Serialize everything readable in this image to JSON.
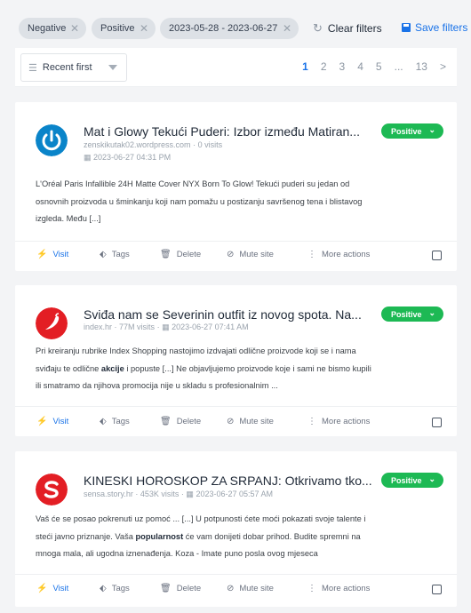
{
  "filters": {
    "chips": [
      {
        "label": "Negative"
      },
      {
        "label": "Positive"
      },
      {
        "label": "2023-05-28 - 2023-06-27"
      }
    ],
    "clear_label": "Clear filters",
    "save_label": "Save filters"
  },
  "toolbar": {
    "sort_label": "Recent first",
    "pages": [
      "1",
      "2",
      "3",
      "4",
      "5",
      "...",
      "13",
      ">"
    ],
    "active_page": "1"
  },
  "colors": {
    "accent": "#1a73e8",
    "positive": "#1db954"
  },
  "results": [
    {
      "title": "Mat i Glowy Tekući Puderi: Izbor između Matiran...",
      "source": "zenskikutak02.wordpress.com",
      "visits": "0 visits",
      "date": "2023-06-27 04:31 PM",
      "sentiment": "Positive",
      "logo_icon": "power-logo-icon",
      "snippet_lines": [
        "L'Oréal Paris Infallible 24H Matte Cover NYX Born To Glow! Tekući puderi su jedan od",
        "osnovnih proizvoda u šminkanju koji nam pomažu u postizanju savršenog tena i blistavog",
        "izgleda. Među [...]"
      ]
    },
    {
      "title": "Sviđa nam se Severinin outfit iz novog spota. Na...",
      "source": "index.hr",
      "visits": "77M visits",
      "date": "2023-06-27 07:41 AM",
      "sentiment": "Positive",
      "logo_icon": "pepper-logo-icon",
      "snippet_lines_pre": "Pri kreiranju rubrike Index Shopping nastojimo izdvajati odlične proizvode koji se i nama",
      "snippet_line2_a": "sviđaju te odlične ",
      "snippet_line2_hl": "akcije",
      "snippet_line2_b": " i popuste [...] Ne objavljujemo proizvode koje i sami ne bismo kupili",
      "snippet_line3": "ili smatramo da njihova promocija nije u skladu s profesionalnim ..."
    },
    {
      "title": "KINESKI HOROSKOP ZA SRPANJ: Otkrivamo tko...",
      "source": "sensa.story.hr",
      "visits": "453K visits",
      "date": "2023-06-27 05:57 AM",
      "sentiment": "Positive",
      "logo_icon": "letter-s-logo-icon",
      "snippet_line1": "Vaš će se posao pokrenuti uz pomoć ... [...] U potpunosti ćete moći pokazati svoje talente i",
      "snippet_line2_a": "steći javno priznanje. Vaša ",
      "snippet_line2_hl": "popularnost",
      "snippet_line2_b": " će vam donijeti dobar prihod. Budite spremni na",
      "snippet_line3": "mnoga mala, ali ugodna iznenađenja. Koza - Imate puno posla ovog mjeseca"
    }
  ],
  "actions": {
    "visit": "Visit",
    "tags": "Tags",
    "delete": "Delete",
    "mute": "Mute site",
    "more": "More actions"
  }
}
